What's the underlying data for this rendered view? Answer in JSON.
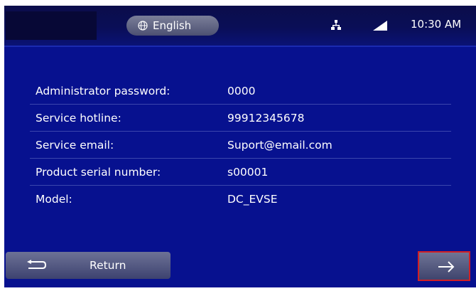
{
  "status_bar": {
    "language": "English",
    "time": "10:30 AM"
  },
  "info": {
    "rows": [
      {
        "label": "Administrator password:",
        "value": "0000"
      },
      {
        "label": "Service hotline:",
        "value": "99912345678"
      },
      {
        "label": "Service email:",
        "value": "Suport@email.com"
      },
      {
        "label": "Product serial number:",
        "value": "s00001"
      },
      {
        "label": "Model:",
        "value": "DC_EVSE"
      }
    ]
  },
  "footer": {
    "return_label": "Return",
    "next_icon": "arrow-right-icon"
  },
  "colors": {
    "background": "#07118f",
    "status_bar": "#0a0e57",
    "highlight_border": "#d11f25"
  }
}
